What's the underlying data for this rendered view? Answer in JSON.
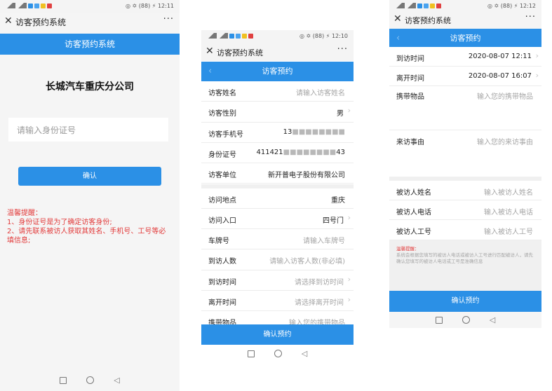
{
  "status_bars": {
    "left": {
      "time": "12:11",
      "extras": "◎ ✡ (88) ⚡"
    },
    "center": {
      "time": "12:10",
      "extras": "◎ ✡ (88) ⚡"
    },
    "right": {
      "time": "12:12",
      "extras": "◎ ✡ (88) ⚡"
    }
  },
  "titlebar": {
    "close": "✕",
    "more": "···",
    "title": "访客预约系统"
  },
  "screen1": {
    "header": "访客预约系统",
    "company": "长城汽车重庆分公司",
    "id_placeholder": "请输入身份证号",
    "confirm": "确认",
    "tip_title": "温馨提醒：",
    "tip_1": "1、身份证号是为了确定访客身份;",
    "tip_2": "2、请先联系被访人获取其姓名、手机号、工号等必填信息;"
  },
  "screen2": {
    "header": "访客预约",
    "back": "‹",
    "rows": [
      {
        "label": "访客姓名",
        "value": "请输入访客姓名",
        "placeholder": true
      },
      {
        "label": "访客性别",
        "value": "男",
        "placeholder": false,
        "chevron": true
      },
      {
        "label": "访客手机号",
        "value": "13",
        "masked": "■■■■■■■■",
        "placeholder": false
      },
      {
        "label": "身份证号",
        "value": "411421",
        "masked": "■■■■■■■■",
        "suffix": "43",
        "placeholder": false
      },
      {
        "label": "访客单位",
        "value": "新开普电子股份有限公司",
        "placeholder": false
      },
      {
        "label": "访问地点",
        "value": "重庆",
        "placeholder": false
      },
      {
        "label": "访问入口",
        "value": "四号门",
        "placeholder": false,
        "chevron": true
      },
      {
        "label": "车牌号",
        "value": "请输入车牌号",
        "placeholder": true
      },
      {
        "label": "到访人数",
        "value": "请输入访客人数(非必填)",
        "placeholder": true
      },
      {
        "label": "到访时间",
        "value": "请选择到访时间",
        "placeholder": true,
        "chevron": true
      },
      {
        "label": "离开时间",
        "value": "请选择离开时间",
        "placeholder": true,
        "chevron": true
      },
      {
        "label": "携带物品",
        "value": "输入您的携带物品",
        "placeholder": true
      }
    ],
    "submit": "确认预约"
  },
  "screen3": {
    "header": "访客预约",
    "arrive_label": "到访时间",
    "arrive_value": "2020-08-07 12:11",
    "leave_label": "离开时间",
    "leave_value": "2020-08-07 16:07",
    "items_label": "携带物品",
    "items_placeholder": "输入您的携带物品",
    "reason_label": "来访事由",
    "reason_placeholder": "输入您的来访事由",
    "host_name_label": "被访人姓名",
    "host_name_placeholder": "输入被访人姓名",
    "host_phone_label": "被访人电话",
    "host_phone_placeholder": "输入被访人电话",
    "host_id_label": "被访人工号",
    "host_id_placeholder": "输入被访人工号",
    "tip_title": "温馨提醒：",
    "tip_text": "系统会根据您填写的被访人电话或被访人工号进行匹配被访人，请先确认您填写的被访人电话或工号是准确信息",
    "submit": "确认预约"
  },
  "nav": {
    "back": "◁"
  },
  "colors": {
    "primary": "#2b90e6",
    "tip_red": "#e23b3b"
  }
}
